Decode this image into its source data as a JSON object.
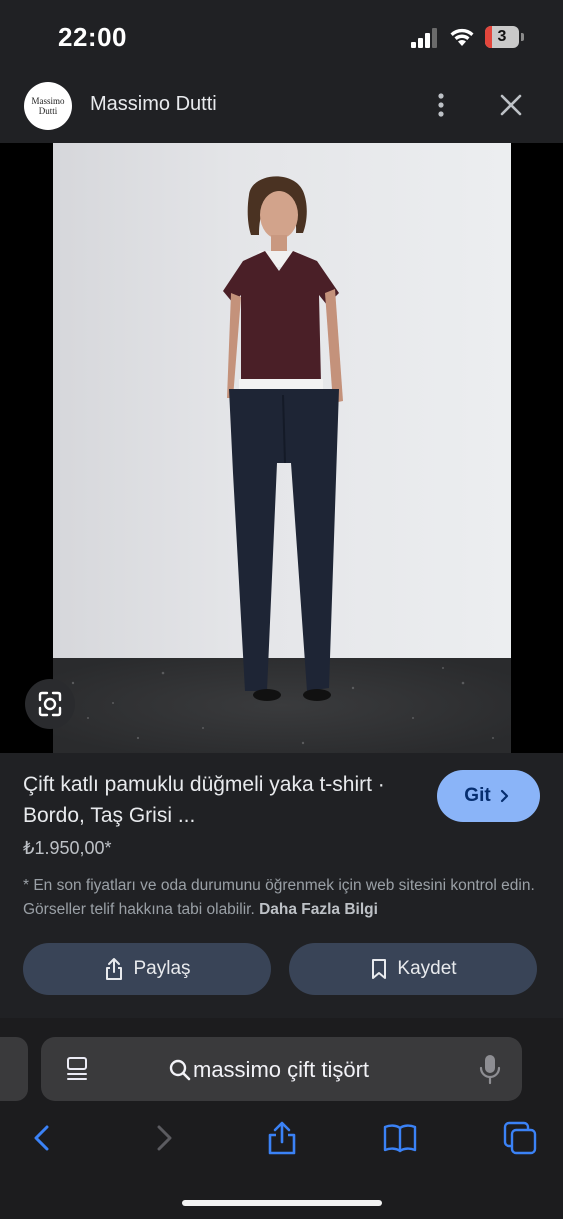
{
  "status_bar": {
    "time": "22:00",
    "battery_level": "3",
    "battery_color": "#e3463c"
  },
  "header": {
    "logo_line1": "Massimo",
    "logo_line2": "Dutti",
    "site_name": "Massimo Dutti"
  },
  "product": {
    "title": "Çift katlı pamuklu düğmeli yaka t-shirt · Bordo, Taş Grisi ...",
    "price": "₺1.950,00*",
    "visit_label": "Git",
    "disclaimer": "* En son fiyatları ve oda durumunu öğrenmek için web sitesini kontrol edin. Görseller telif hakkına tabi olabilir.",
    "more_info_link": "Daha Fazla Bilgi"
  },
  "actions": {
    "share_label": "Paylaş",
    "save_label": "Kaydet"
  },
  "browser": {
    "address_text": "massimo çift tişört"
  },
  "colors": {
    "accent": "#8ab4f8",
    "action_button": "#394457",
    "panel": "#202124",
    "link_blue": "#3b82f6"
  },
  "icons": [
    "more-vertical-icon",
    "close-icon",
    "lens-icon",
    "share-icon",
    "bookmark-icon",
    "reader-icon",
    "search-icon",
    "mic-icon",
    "back-icon",
    "forward-icon",
    "book-icon",
    "tabs-icon"
  ]
}
